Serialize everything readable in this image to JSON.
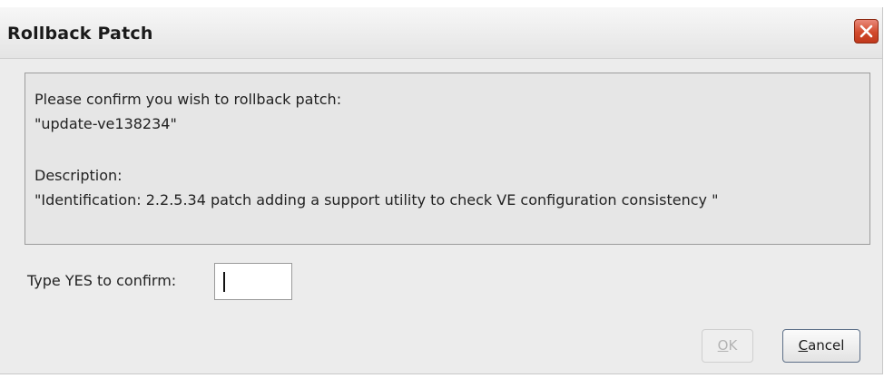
{
  "dialog": {
    "title": "Rollback Patch",
    "close_icon": "close-icon",
    "message": {
      "line1": "Please confirm you wish to rollback patch:",
      "line2": "\"update-ve138234\"",
      "line3": "Description:",
      "line4": "\"Identification: 2.2.5.34 patch adding a support utility to check VE configuration consistency \""
    },
    "confirm": {
      "label": "Type YES to confirm:",
      "value": ""
    },
    "buttons": {
      "ok": {
        "mnemonic": "O",
        "rest": "K",
        "enabled": false
      },
      "cancel": {
        "mnemonic": "C",
        "rest": "ancel",
        "enabled": true
      }
    }
  },
  "colors": {
    "close_button": "#d24a2c",
    "panel_background": "#e6e6e6",
    "dialog_background": "#ececec"
  }
}
